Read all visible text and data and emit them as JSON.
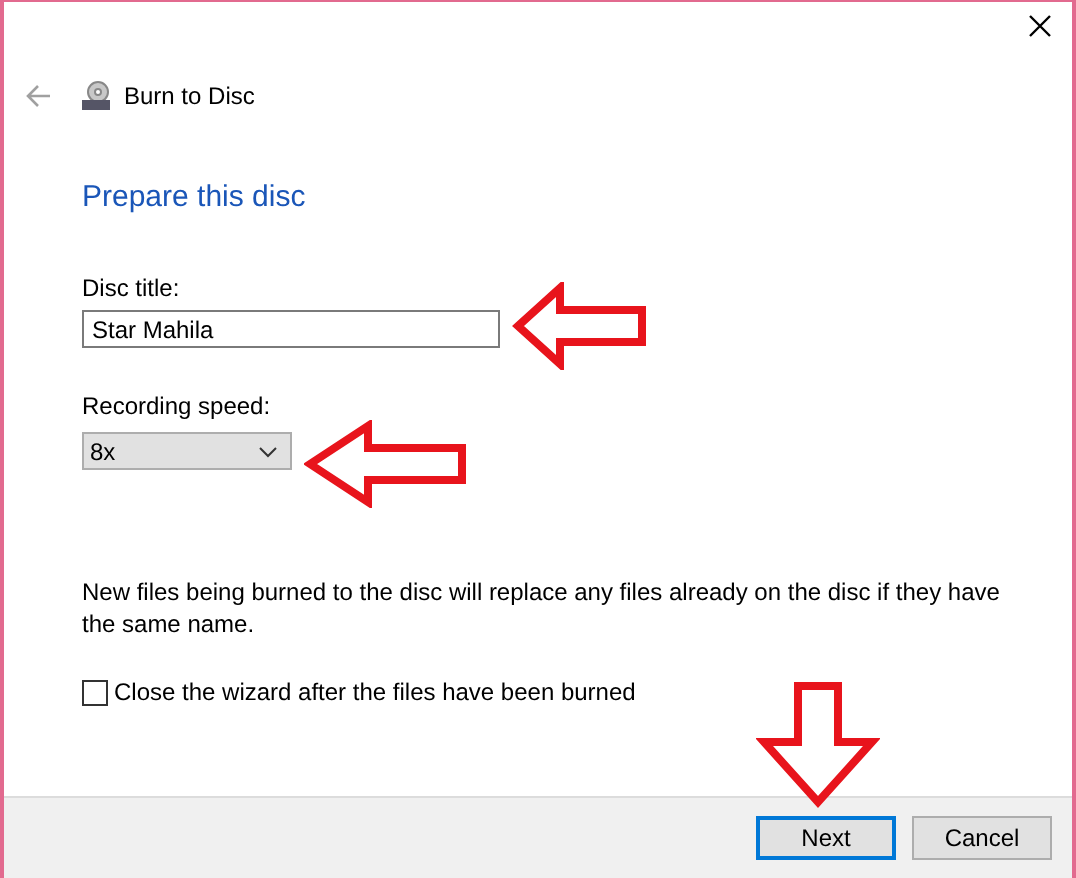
{
  "window": {
    "title": "Burn to Disc"
  },
  "heading": "Prepare this disc",
  "disc_title": {
    "label": "Disc title:",
    "value": "Star Mahila"
  },
  "recording_speed": {
    "label": "Recording speed:",
    "value": "8x"
  },
  "note": "New files being burned to the disc will replace any files already on the disc if they have the same name.",
  "close_wizard": {
    "label": "Close the wizard after the files have been burned",
    "checked": false
  },
  "buttons": [
    {
      "label": "Next",
      "default": true
    },
    {
      "label": "Cancel",
      "default": false
    }
  ]
}
